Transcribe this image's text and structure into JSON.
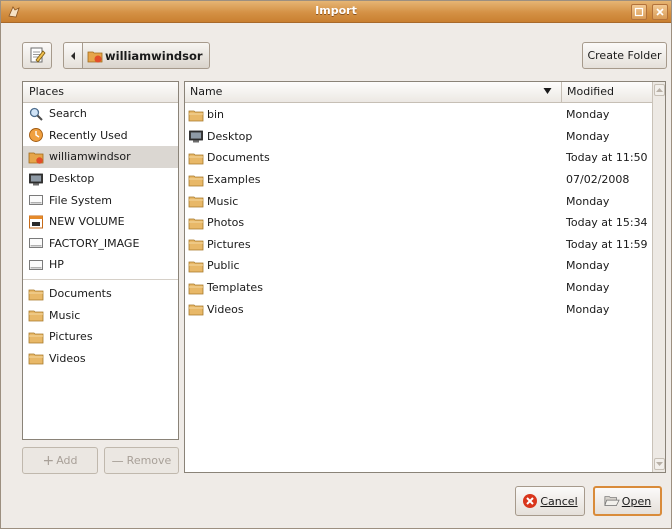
{
  "window": {
    "title": "Import"
  },
  "toolbar": {
    "location": "williamwindsor",
    "create_folder_label": "Create Folder"
  },
  "places": {
    "header": "Places",
    "items": [
      {
        "label": "Search",
        "icon": "search-icon"
      },
      {
        "label": "Recently Used",
        "icon": "recent-icon"
      },
      {
        "label": "williamwindsor",
        "icon": "home-folder-icon",
        "selected": true
      },
      {
        "label": "Desktop",
        "icon": "desktop-icon"
      },
      {
        "label": "File System",
        "icon": "drive-icon"
      },
      {
        "label": "NEW VOLUME",
        "icon": "volume-icon"
      },
      {
        "label": "FACTORY_IMAGE",
        "icon": "drive-icon"
      },
      {
        "label": "HP",
        "icon": "drive-icon"
      }
    ],
    "bookmarks": [
      {
        "label": "Documents",
        "icon": "folder-icon"
      },
      {
        "label": "Music",
        "icon": "folder-icon"
      },
      {
        "label": "Pictures",
        "icon": "folder-icon"
      },
      {
        "label": "Videos",
        "icon": "folder-icon"
      }
    ],
    "add_label": "Add",
    "remove_label": "Remove"
  },
  "files": {
    "columns": {
      "name": "Name",
      "modified": "Modified"
    },
    "rows": [
      {
        "name": "bin",
        "modified": "Monday",
        "icon": "folder-icon"
      },
      {
        "name": "Desktop",
        "modified": "Monday",
        "icon": "desktop-icon"
      },
      {
        "name": "Documents",
        "modified": "Today at 11:50",
        "icon": "folder-icon"
      },
      {
        "name": "Examples",
        "modified": "07/02/2008",
        "icon": "folder-icon"
      },
      {
        "name": "Music",
        "modified": "Monday",
        "icon": "folder-icon"
      },
      {
        "name": "Photos",
        "modified": "Today at 15:34",
        "icon": "folder-icon"
      },
      {
        "name": "Pictures",
        "modified": "Today at 11:59",
        "icon": "folder-icon"
      },
      {
        "name": "Public",
        "modified": "Monday",
        "icon": "folder-icon"
      },
      {
        "name": "Templates",
        "modified": "Monday",
        "icon": "folder-icon"
      },
      {
        "name": "Videos",
        "modified": "Monday",
        "icon": "folder-icon"
      }
    ]
  },
  "buttons": {
    "cancel_label": "Cancel",
    "open_label": "Open"
  },
  "colors": {
    "titlebar": "#d49145",
    "selected_row": "#dbd7d2",
    "default_button_border": "#d98b3a"
  }
}
